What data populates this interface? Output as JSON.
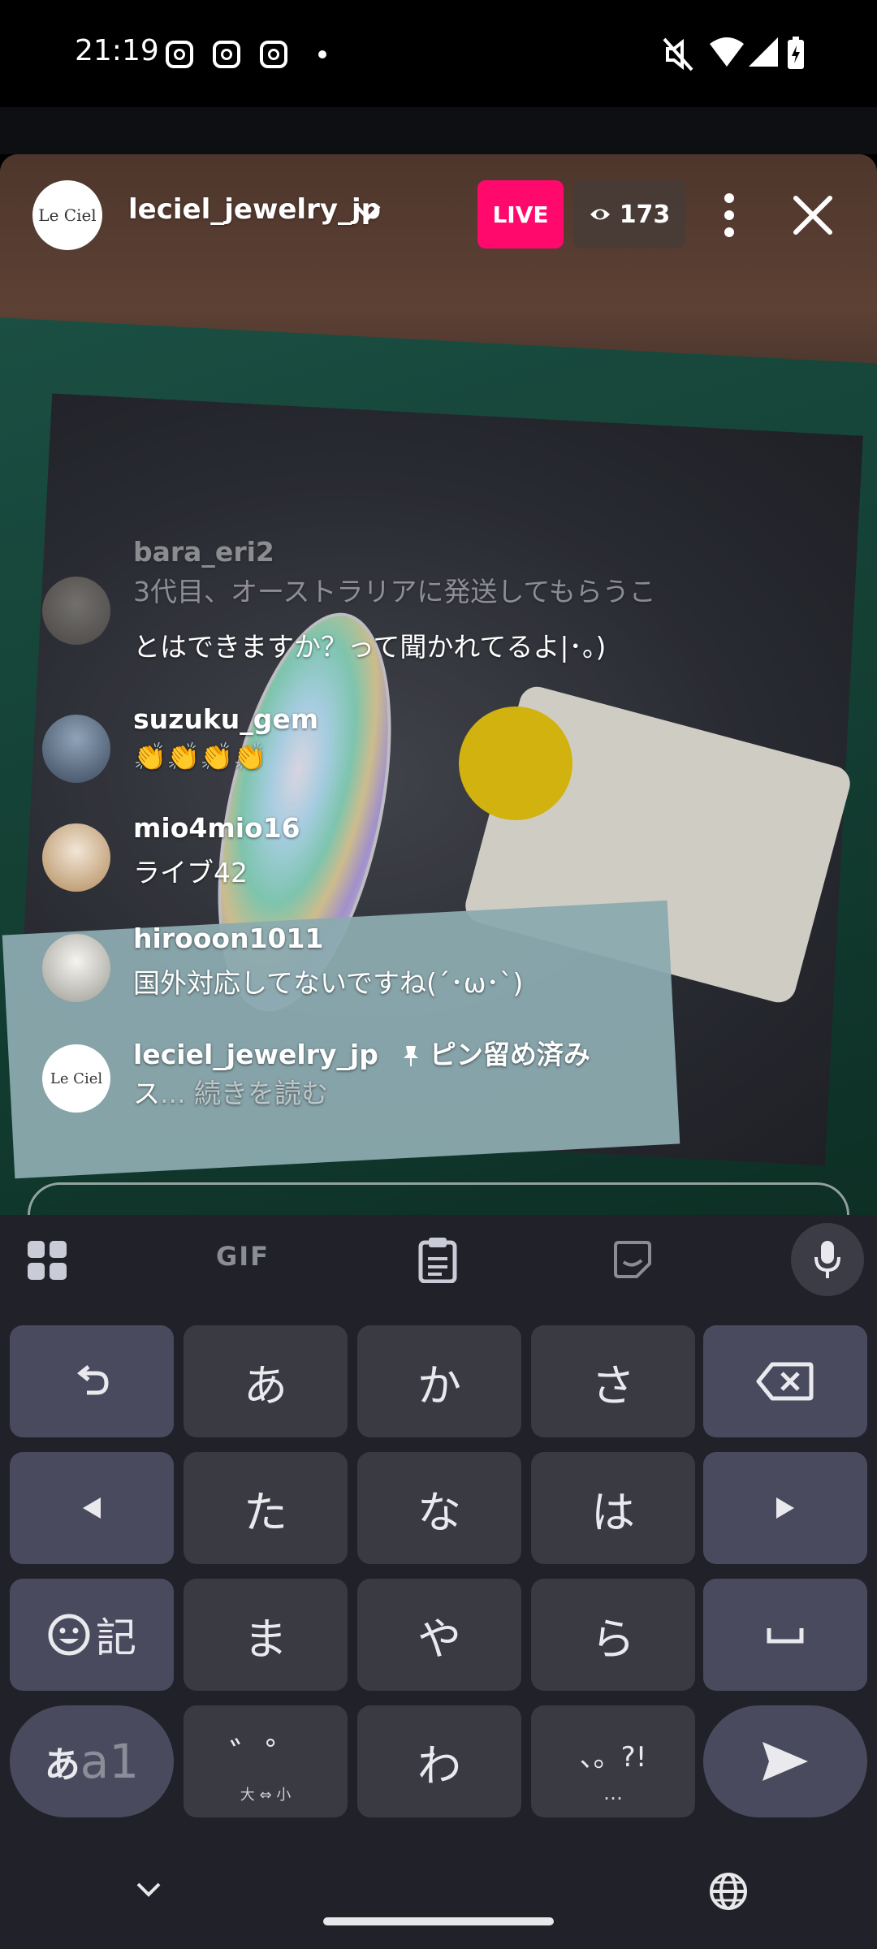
{
  "status": {
    "time": "21:19",
    "notification_icons": [
      "instagram-icon",
      "instagram-icon",
      "instagram-icon"
    ],
    "system_icons": [
      "mute-icon",
      "wifi-icon",
      "signal-icon",
      "battery-charging-icon"
    ]
  },
  "live": {
    "host_logo": "Le Ciel",
    "host": "leciel_jewelry_jp",
    "live_label": "LIVE",
    "viewers": "173",
    "comments": [
      {
        "user": "bara_eri2",
        "lines": [
          "3代目、オーストラリアに発送してもらうこ",
          "とはできますか？って聞かれてるよ|･。)"
        ]
      },
      {
        "user": "suzuku_gem",
        "lines": [
          "👏👏👏👏"
        ]
      },
      {
        "user": "mio4mio16",
        "lines": [
          "ライブ42"
        ]
      },
      {
        "user": "hirooon1011",
        "lines": [
          "国外対応してないですね(´･ω･`)"
        ]
      },
      {
        "user": "leciel_jewelry_jp",
        "pin": "ピン留め済み",
        "text": "ス",
        "read_more": "... 続きを読む"
      }
    ]
  },
  "keyboard": {
    "toolbar": [
      "apps-grid-icon",
      "GIF",
      "clipboard-icon",
      "sticker-icon",
      "mic-icon"
    ],
    "gif_label": "GIF",
    "rows": [
      [
        "undo-icon",
        "あ",
        "か",
        "さ",
        "backspace-icon"
      ],
      [
        "left-arrow-icon",
        "た",
        "な",
        "は",
        "right-arrow-icon"
      ],
      [
        "emoji-記",
        "ま",
        "や",
        "ら",
        "space-icon"
      ],
      [
        "あa1",
        "゛゜",
        "わ",
        "、。?!",
        "send-icon"
      ]
    ],
    "keys": {
      "a": "あ",
      "ka": "か",
      "sa": "さ",
      "ta": "た",
      "na": "な",
      "ha": "は",
      "ma": "ま",
      "ya": "や",
      "ra": "ら",
      "kigou": "記",
      "mode_a": "あ",
      "mode_a1": "a1",
      "dakuten": "゛゜",
      "dakuten_sub": "大 ⇔ 小",
      "wa": "わ",
      "punct": "、。?!",
      "punct_sub": "…"
    }
  }
}
